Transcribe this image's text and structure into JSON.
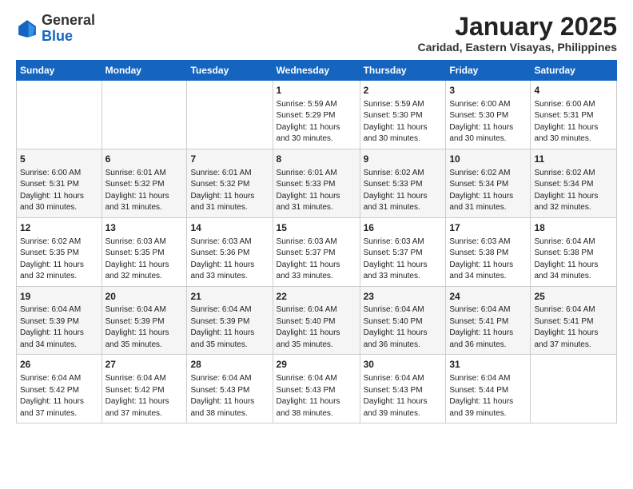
{
  "logo": {
    "general": "General",
    "blue": "Blue"
  },
  "header": {
    "month": "January 2025",
    "location": "Caridad, Eastern Visayas, Philippines"
  },
  "weekdays": [
    "Sunday",
    "Monday",
    "Tuesday",
    "Wednesday",
    "Thursday",
    "Friday",
    "Saturday"
  ],
  "weeks": [
    [
      {
        "day": "",
        "info": ""
      },
      {
        "day": "",
        "info": ""
      },
      {
        "day": "",
        "info": ""
      },
      {
        "day": "1",
        "info": "Sunrise: 5:59 AM\nSunset: 5:29 PM\nDaylight: 11 hours\nand 30 minutes."
      },
      {
        "day": "2",
        "info": "Sunrise: 5:59 AM\nSunset: 5:30 PM\nDaylight: 11 hours\nand 30 minutes."
      },
      {
        "day": "3",
        "info": "Sunrise: 6:00 AM\nSunset: 5:30 PM\nDaylight: 11 hours\nand 30 minutes."
      },
      {
        "day": "4",
        "info": "Sunrise: 6:00 AM\nSunset: 5:31 PM\nDaylight: 11 hours\nand 30 minutes."
      }
    ],
    [
      {
        "day": "5",
        "info": "Sunrise: 6:00 AM\nSunset: 5:31 PM\nDaylight: 11 hours\nand 30 minutes."
      },
      {
        "day": "6",
        "info": "Sunrise: 6:01 AM\nSunset: 5:32 PM\nDaylight: 11 hours\nand 31 minutes."
      },
      {
        "day": "7",
        "info": "Sunrise: 6:01 AM\nSunset: 5:32 PM\nDaylight: 11 hours\nand 31 minutes."
      },
      {
        "day": "8",
        "info": "Sunrise: 6:01 AM\nSunset: 5:33 PM\nDaylight: 11 hours\nand 31 minutes."
      },
      {
        "day": "9",
        "info": "Sunrise: 6:02 AM\nSunset: 5:33 PM\nDaylight: 11 hours\nand 31 minutes."
      },
      {
        "day": "10",
        "info": "Sunrise: 6:02 AM\nSunset: 5:34 PM\nDaylight: 11 hours\nand 31 minutes."
      },
      {
        "day": "11",
        "info": "Sunrise: 6:02 AM\nSunset: 5:34 PM\nDaylight: 11 hours\nand 32 minutes."
      }
    ],
    [
      {
        "day": "12",
        "info": "Sunrise: 6:02 AM\nSunset: 5:35 PM\nDaylight: 11 hours\nand 32 minutes."
      },
      {
        "day": "13",
        "info": "Sunrise: 6:03 AM\nSunset: 5:35 PM\nDaylight: 11 hours\nand 32 minutes."
      },
      {
        "day": "14",
        "info": "Sunrise: 6:03 AM\nSunset: 5:36 PM\nDaylight: 11 hours\nand 33 minutes."
      },
      {
        "day": "15",
        "info": "Sunrise: 6:03 AM\nSunset: 5:37 PM\nDaylight: 11 hours\nand 33 minutes."
      },
      {
        "day": "16",
        "info": "Sunrise: 6:03 AM\nSunset: 5:37 PM\nDaylight: 11 hours\nand 33 minutes."
      },
      {
        "day": "17",
        "info": "Sunrise: 6:03 AM\nSunset: 5:38 PM\nDaylight: 11 hours\nand 34 minutes."
      },
      {
        "day": "18",
        "info": "Sunrise: 6:04 AM\nSunset: 5:38 PM\nDaylight: 11 hours\nand 34 minutes."
      }
    ],
    [
      {
        "day": "19",
        "info": "Sunrise: 6:04 AM\nSunset: 5:39 PM\nDaylight: 11 hours\nand 34 minutes."
      },
      {
        "day": "20",
        "info": "Sunrise: 6:04 AM\nSunset: 5:39 PM\nDaylight: 11 hours\nand 35 minutes."
      },
      {
        "day": "21",
        "info": "Sunrise: 6:04 AM\nSunset: 5:39 PM\nDaylight: 11 hours\nand 35 minutes."
      },
      {
        "day": "22",
        "info": "Sunrise: 6:04 AM\nSunset: 5:40 PM\nDaylight: 11 hours\nand 35 minutes."
      },
      {
        "day": "23",
        "info": "Sunrise: 6:04 AM\nSunset: 5:40 PM\nDaylight: 11 hours\nand 36 minutes."
      },
      {
        "day": "24",
        "info": "Sunrise: 6:04 AM\nSunset: 5:41 PM\nDaylight: 11 hours\nand 36 minutes."
      },
      {
        "day": "25",
        "info": "Sunrise: 6:04 AM\nSunset: 5:41 PM\nDaylight: 11 hours\nand 37 minutes."
      }
    ],
    [
      {
        "day": "26",
        "info": "Sunrise: 6:04 AM\nSunset: 5:42 PM\nDaylight: 11 hours\nand 37 minutes."
      },
      {
        "day": "27",
        "info": "Sunrise: 6:04 AM\nSunset: 5:42 PM\nDaylight: 11 hours\nand 37 minutes."
      },
      {
        "day": "28",
        "info": "Sunrise: 6:04 AM\nSunset: 5:43 PM\nDaylight: 11 hours\nand 38 minutes."
      },
      {
        "day": "29",
        "info": "Sunrise: 6:04 AM\nSunset: 5:43 PM\nDaylight: 11 hours\nand 38 minutes."
      },
      {
        "day": "30",
        "info": "Sunrise: 6:04 AM\nSunset: 5:43 PM\nDaylight: 11 hours\nand 39 minutes."
      },
      {
        "day": "31",
        "info": "Sunrise: 6:04 AM\nSunset: 5:44 PM\nDaylight: 11 hours\nand 39 minutes."
      },
      {
        "day": "",
        "info": ""
      }
    ]
  ]
}
